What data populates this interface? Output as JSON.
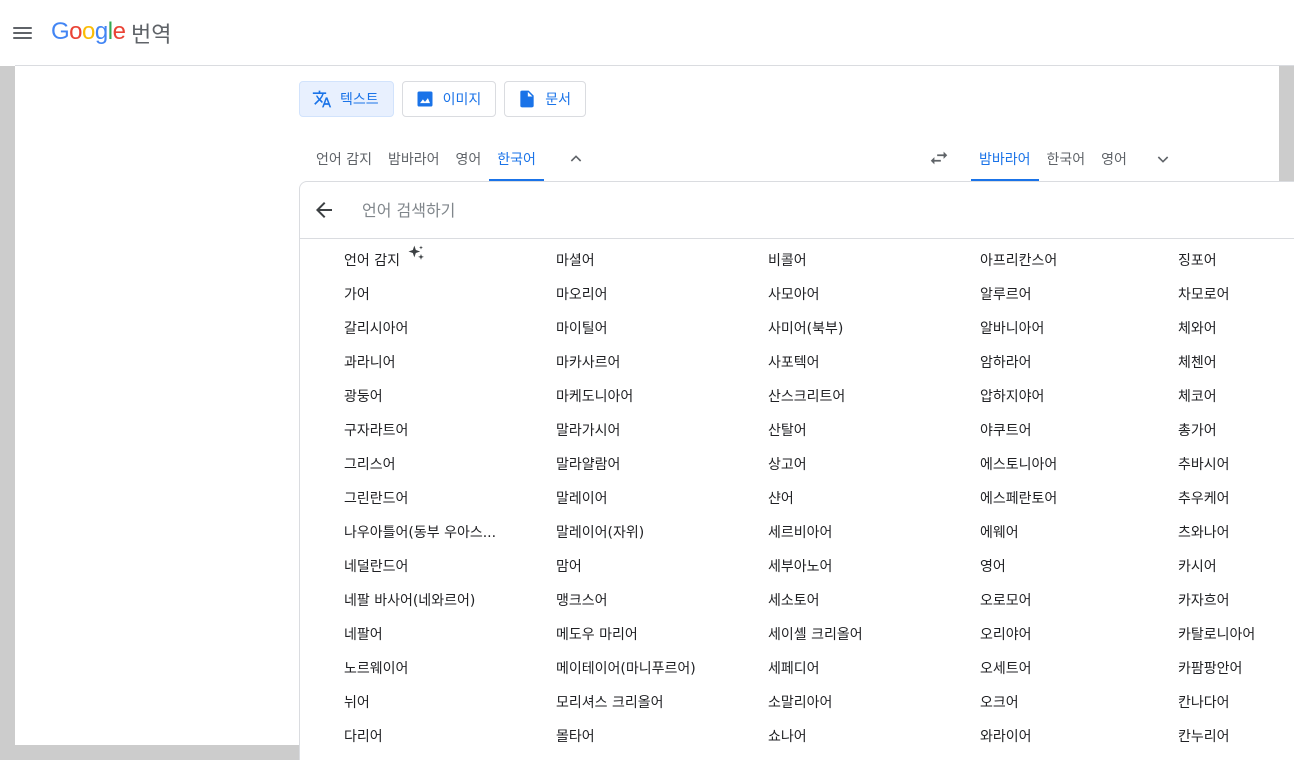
{
  "header": {
    "logo_letters": [
      "G",
      "o",
      "o",
      "g",
      "l",
      "e"
    ],
    "logo_colors": [
      "#4285f4",
      "#ea4335",
      "#fbbc05",
      "#4285f4",
      "#34a853",
      "#ea4335"
    ],
    "product": "번역"
  },
  "modes": [
    {
      "label": "텍스트",
      "icon": "translate-icon",
      "active": true
    },
    {
      "label": "이미지",
      "icon": "image-icon",
      "active": false
    },
    {
      "label": "문서",
      "icon": "document-icon",
      "active": false
    }
  ],
  "source_tabs": [
    {
      "label": "언어 감지",
      "active": false
    },
    {
      "label": "밤바라어",
      "active": false
    },
    {
      "label": "영어",
      "active": false
    },
    {
      "label": "한국어",
      "active": true
    }
  ],
  "target_tabs": [
    {
      "label": "밤바라어",
      "active": true
    },
    {
      "label": "한국어",
      "active": false
    },
    {
      "label": "영어",
      "active": false
    }
  ],
  "search": {
    "placeholder": "언어 검색하기"
  },
  "languages": [
    [
      "언어 감지",
      "가어",
      "갈리시아어",
      "과라니어",
      "광둥어",
      "구자라트어",
      "그리스어",
      "그린란드어",
      "나우아틀어(동부 우아스...",
      "네덜란드어",
      "네팔 바사어(네와르어)",
      "네팔어",
      "노르웨이어",
      "뉘어",
      "다리어"
    ],
    [
      "마셜어",
      "마오리어",
      "마이틸어",
      "마카사르어",
      "마케도니아어",
      "말라가시어",
      "말라얄람어",
      "말레이어",
      "말레이어(자위)",
      "맘어",
      "맹크스어",
      "메도우 마리어",
      "메이테이어(마니푸르어)",
      "모리셔스 크리올어",
      "몰타어"
    ],
    [
      "비콜어",
      "사모아어",
      "사미어(북부)",
      "사포텍어",
      "산스크리트어",
      "산탈어",
      "상고어",
      "샨어",
      "세르비아어",
      "세부아노어",
      "세소토어",
      "세이셸 크리올어",
      "세페디어",
      "소말리아어",
      "쇼나어"
    ],
    [
      "아프리칸스어",
      "알루르어",
      "알바니아어",
      "암하라어",
      "압하지야어",
      "야쿠트어",
      "에스토니아어",
      "에스페란토어",
      "에웨어",
      "영어",
      "오로모어",
      "오리야어",
      "오세트어",
      "오크어",
      "와라이어"
    ],
    [
      "징포어",
      "차모로어",
      "체와어",
      "체첸어",
      "체코어",
      "총가어",
      "추바시어",
      "추우케어",
      "츠와나어",
      "카시어",
      "카자흐어",
      "카탈로니아어",
      "카팜팡안어",
      "칸나다어",
      "칸누리어"
    ]
  ],
  "colors": {
    "accent": "#1a73e8",
    "active_bg": "#e8f0fe",
    "text_muted": "#5f6368"
  }
}
